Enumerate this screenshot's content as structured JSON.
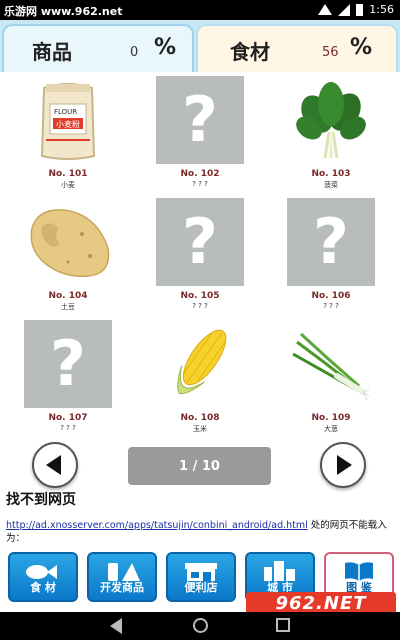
{
  "status_bar": {
    "watermark": "乐游网 www.962.net",
    "time": "1:56"
  },
  "tabs": [
    {
      "label": "商品",
      "value": "0",
      "pct": "%"
    },
    {
      "label": "食材",
      "value": "56",
      "pct": "%"
    }
  ],
  "items": [
    {
      "no": "No. 101",
      "name": "小麦",
      "icon": "flour-bag-icon",
      "unknown": false,
      "bag_text": "FLOUR",
      "bag_cn": "小麦粉"
    },
    {
      "no": "No. 102",
      "name": "? ? ?",
      "icon": "question-mark-icon",
      "unknown": true,
      "mark": "?"
    },
    {
      "no": "No. 103",
      "name": "菠菜",
      "icon": "spinach-icon",
      "unknown": false
    },
    {
      "no": "No. 104",
      "name": "土豆",
      "icon": "potato-icon",
      "unknown": false
    },
    {
      "no": "No. 105",
      "name": "? ? ?",
      "icon": "question-mark-icon",
      "unknown": true,
      "mark": "?"
    },
    {
      "no": "No. 106",
      "name": "? ? ?",
      "icon": "question-mark-icon",
      "unknown": true,
      "mark": "?"
    },
    {
      "no": "No. 107",
      "name": "? ? ?",
      "icon": "question-mark-icon",
      "unknown": true,
      "mark": "?"
    },
    {
      "no": "No. 108",
      "name": "玉米",
      "icon": "corn-icon",
      "unknown": false
    },
    {
      "no": "No. 109",
      "name": "大葱",
      "icon": "green-onion-icon",
      "unknown": false
    }
  ],
  "pager": {
    "indicator": "1 / 10"
  },
  "error": {
    "title": "找不到网页",
    "link": "http://ad.xnosserver.com/apps/tatsujin/conbini_android/ad.html",
    "suffix": " 处的网页不能载入为："
  },
  "bottom_nav": [
    {
      "label": "食 材",
      "icon": "food-icon"
    },
    {
      "label": "开发商品",
      "icon": "product-dev-icon"
    },
    {
      "label": "便利店",
      "icon": "store-icon"
    },
    {
      "label": "城 市",
      "icon": "city-icon"
    },
    {
      "label": "图 鉴",
      "icon": "book-icon"
    }
  ],
  "watermark_logo": "962.NET",
  "colors": {
    "tab_bg": "#c7e8f6",
    "nav_blue": "#0b78c9",
    "accent_number": "#7a2a2a"
  }
}
